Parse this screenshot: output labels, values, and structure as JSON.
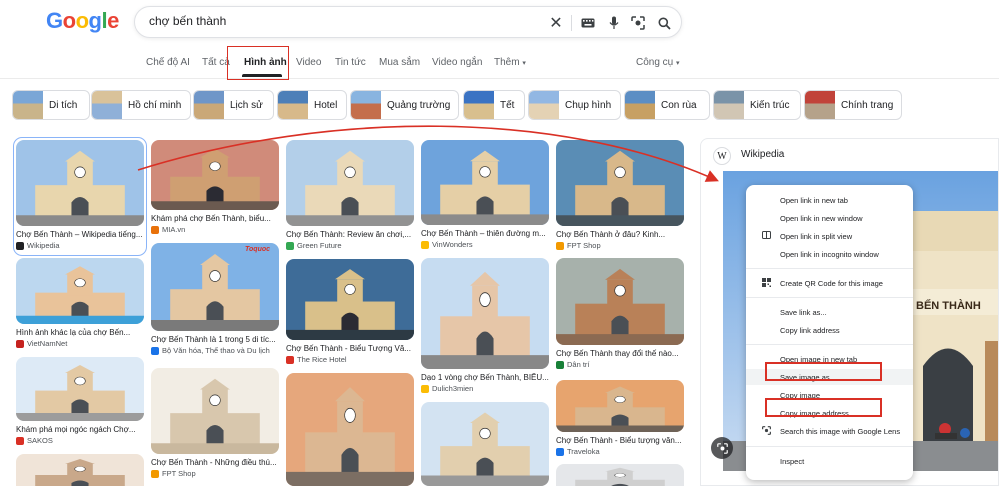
{
  "header": {
    "logo_letters": [
      {
        "ch": "G",
        "color": "#4285f4"
      },
      {
        "ch": "o",
        "color": "#ea4335"
      },
      {
        "ch": "o",
        "color": "#fbbc05"
      },
      {
        "ch": "g",
        "color": "#4285f4"
      },
      {
        "ch": "l",
        "color": "#34a853"
      },
      {
        "ch": "e",
        "color": "#ea4335"
      }
    ],
    "search_value": "chợ bến thành"
  },
  "tabs": {
    "ai_mode": "Chế độ AI",
    "all": "Tất cả",
    "images": "Hình ảnh",
    "videos": "Video",
    "news": "Tin tức",
    "shopping": "Mua sắm",
    "short_videos": "Video ngắn",
    "more": "Thêm",
    "tools": "Công cụ"
  },
  "chips": [
    "Di tích",
    "Hồ chí minh",
    "Lịch sử",
    "Hotel",
    "Quảng trường",
    "Tết",
    "Chụp hình",
    "Con rùa",
    "Kiến trúc",
    "Chính trang"
  ],
  "results": {
    "c1": [
      {
        "caption": "Chợ Bến Thành – Wikipedia tiếng...",
        "source": "Wikipedia"
      },
      {
        "caption": "Hình ảnh khác lạ của chợ Bến...",
        "source": "VietNamNet"
      },
      {
        "caption": "Khám phá mọi ngóc ngách Chợ...",
        "source": "SAKOS"
      }
    ],
    "c2": [
      {
        "caption": "Khám phá chợ Bến Thành, biểu...",
        "source": "MIA.vn"
      },
      {
        "caption": "Chợ Bến Thành là 1 trong 5 di tíc...",
        "source": "Bộ Văn hóa, Thể thao và Du lịch",
        "badge": "Toquoc"
      },
      {
        "caption": "Chợ Bến Thành - Những điều thú...",
        "source": "FPT Shop"
      }
    ],
    "c3": [
      {
        "caption": "Chợ Bến Thành: Review ăn chơi,...",
        "source": "Green Future"
      },
      {
        "caption": "Chợ Bến Thành - Biểu Tượng Vă...",
        "source": "The Rice Hotel"
      }
    ],
    "c4": [
      {
        "caption": "Chợ Bến Thành – thiên đường m...",
        "source": "VinWonders"
      },
      {
        "caption": "Dạo 1 vòng chợ Bến Thành, BIỂU...",
        "source": "Dulich3mien"
      }
    ],
    "c5": [
      {
        "caption": "Chợ Bến Thành ở đâu? Kinh...",
        "source": "FPT Shop"
      },
      {
        "caption": "Chợ Bến Thành thay đổi thế nào...",
        "source": "Dân trí"
      },
      {
        "caption": "Chợ Bến Thành - Biểu tượng văn...",
        "source": "Traveloka"
      }
    ]
  },
  "panel": {
    "source_icon": "W",
    "source_name": "Wikipedia",
    "sign_text": "BẾN THÀNH"
  },
  "context_menu": {
    "items": [
      {
        "label": "Open link in new tab"
      },
      {
        "label": "Open link in new window"
      },
      {
        "label": "Open link in split view",
        "icon": "split-view-icon"
      },
      {
        "label": "Open link in incognito window"
      },
      {
        "label": "Create QR Code for this image",
        "icon": "qr-code-icon"
      },
      {
        "label": "Save link as..."
      },
      {
        "label": "Copy link address"
      },
      {
        "label": "Open image in new tab"
      },
      {
        "label": "Save image as..."
      },
      {
        "label": "Copy image"
      },
      {
        "label": "Copy image address"
      },
      {
        "label": "Search this image with Google Lens",
        "icon": "lens-icon"
      },
      {
        "label": "Inspect"
      }
    ]
  },
  "colors": {
    "annotation_red": "#d93025",
    "google_blue": "#4285f4",
    "selection_blue": "#8ab4f8"
  }
}
